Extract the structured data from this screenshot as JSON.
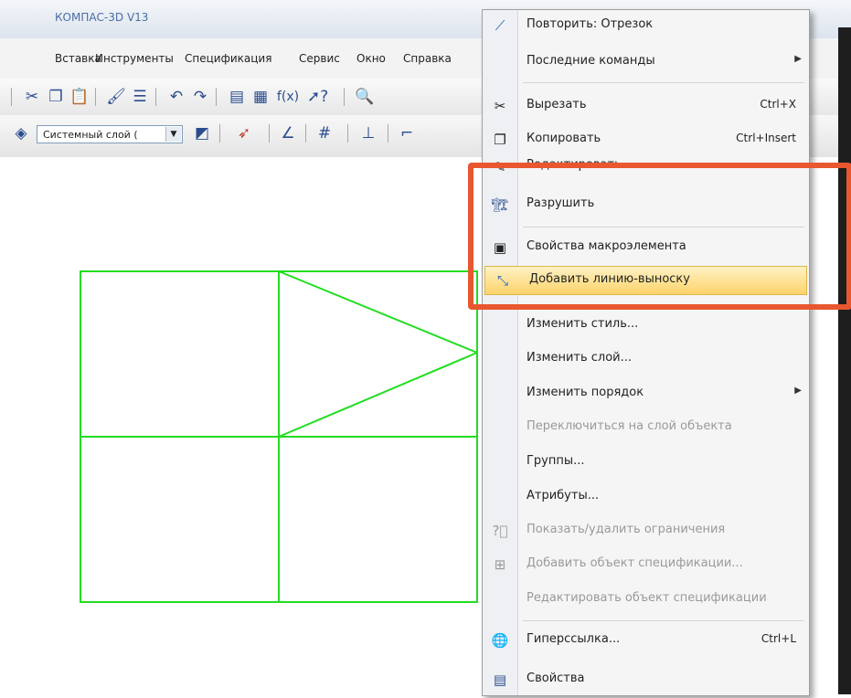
{
  "window": {
    "title": "КОМПАС-3D V13"
  },
  "menubar": {
    "items": [
      {
        "label": "Вставка",
        "x_hint": "insert"
      },
      {
        "label": "Инструменты"
      },
      {
        "label": "Спецификация"
      },
      {
        "label": "Сервис"
      },
      {
        "label": "Окно"
      },
      {
        "label": "Справка"
      }
    ]
  },
  "toolbar": {
    "layer_combo": "Системный слой (",
    "icons": [
      "cut-icon",
      "copy-icon",
      "paste-icon",
      "brush-icon",
      "list-icon",
      "undo-icon",
      "redo-icon",
      "manager-icon",
      "libraries-icon",
      "fx-icon",
      "help-pointer-icon",
      "zoom-icon"
    ],
    "icons2": [
      "layer-icon",
      "props-icon",
      "magnet-icon",
      "angle-icon",
      "grid-icon",
      "axis-icon",
      "line-icon"
    ]
  },
  "context_menu": {
    "items": [
      {
        "label": "Повторить: Отрезок",
        "icon": "segment-icon"
      },
      {
        "label": "Последние команды",
        "submenu": true
      },
      {
        "label": "Вырезать",
        "shortcut": "Ctrl+X",
        "icon": "scissors-icon"
      },
      {
        "label": "Копировать",
        "shortcut": "Ctrl+Insert",
        "icon": "copy-icon"
      },
      {
        "label": "Редактировать",
        "icon": "edit-icon"
      },
      {
        "label": "Разрушить",
        "icon": "destroy-icon"
      },
      {
        "label": "Свойства макроэлемента",
        "icon": "macro-props-icon"
      },
      {
        "label": "Добавить линию-выноску",
        "icon": "leader-line-icon",
        "highlighted": true
      },
      {
        "label": "Изменить стиль..."
      },
      {
        "label": "Изменить слой..."
      },
      {
        "label": "Изменить порядок",
        "submenu": true
      },
      {
        "label": "Переключиться на слой объекта",
        "disabled": true
      },
      {
        "label": "Группы..."
      },
      {
        "label": "Атрибуты..."
      },
      {
        "label": "Показать/удалить ограничения",
        "disabled": true,
        "icon": "constraints-icon"
      },
      {
        "label": "Добавить объект спецификации...",
        "disabled": true,
        "icon": "spec-add-icon"
      },
      {
        "label": "Редактировать объект спецификации",
        "disabled": true
      },
      {
        "label": "Гиперссылка...",
        "shortcut": "Ctrl+L",
        "icon": "hyperlink-icon"
      },
      {
        "label": "Свойства",
        "icon": "properties-icon"
      }
    ]
  },
  "colors": {
    "drawing": "#22dd22",
    "highlight_box": "#e8572f"
  }
}
